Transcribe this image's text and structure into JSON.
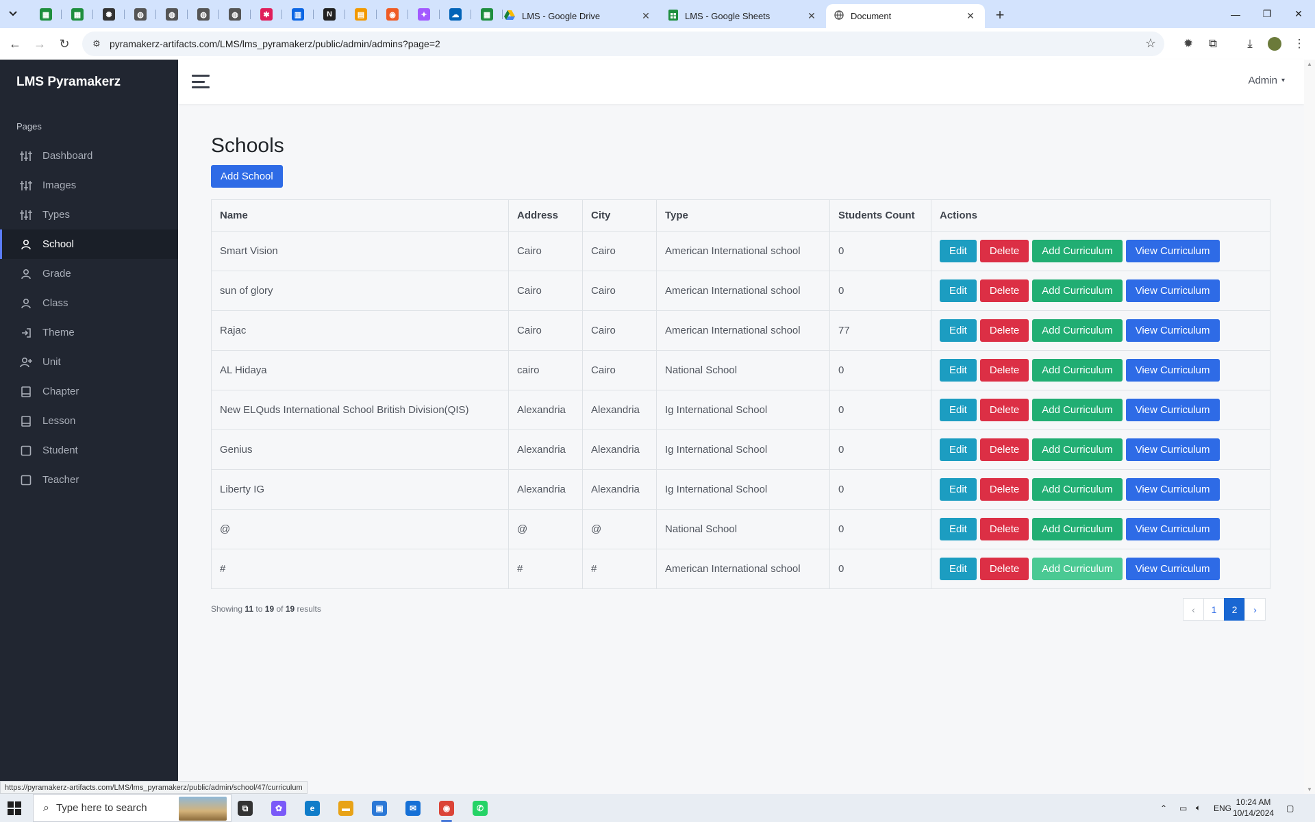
{
  "browser": {
    "pinned_tabs": [
      {
        "icon": "sheets-icon",
        "color": "#1e8e3e",
        "glyph": "▦"
      },
      {
        "icon": "sheets-icon",
        "color": "#1e8e3e",
        "glyph": "▦"
      },
      {
        "icon": "openai-icon",
        "color": "#333333",
        "glyph": "✺"
      },
      {
        "icon": "globe-icon",
        "color": "#555555",
        "glyph": "◍"
      },
      {
        "icon": "globe-icon",
        "color": "#555555",
        "glyph": "◍"
      },
      {
        "icon": "globe-icon",
        "color": "#555555",
        "glyph": "◍"
      },
      {
        "icon": "globe-icon",
        "color": "#555555",
        "glyph": "◍"
      },
      {
        "icon": "slack-icon",
        "color": "#e01e5a",
        "glyph": "✱"
      },
      {
        "icon": "trello-icon",
        "color": "#0c66e4",
        "glyph": "▥"
      },
      {
        "icon": "notion-icon",
        "color": "#222222",
        "glyph": "N"
      },
      {
        "icon": "slides-icon",
        "color": "#f29900",
        "glyph": "▤"
      },
      {
        "icon": "postman-icon",
        "color": "#ef5b25",
        "glyph": "◉"
      },
      {
        "icon": "figma-icon",
        "color": "#a259ff",
        "glyph": "✦"
      },
      {
        "icon": "onedrive-icon",
        "color": "#0364b8",
        "glyph": "☁"
      },
      {
        "icon": "sheets-icon",
        "color": "#1e8e3e",
        "glyph": "▦"
      }
    ],
    "tabs": [
      {
        "title": "LMS - Google Drive",
        "icon": "drive-icon"
      },
      {
        "title": "LMS - Google Sheets",
        "icon": "sheets-icon"
      },
      {
        "title": "Document",
        "icon": "globe-icon"
      }
    ],
    "url": "pyramakerz-artifacts.com/LMS/lms_pyramakerz/public/admin/admins?page=2",
    "status_url": "https://pyramakerz-artifacts.com/LMS/lms_pyramakerz/public/admin/school/47/curriculum"
  },
  "sidebar": {
    "brand": "LMS Pyramakerz",
    "heading": "Pages",
    "items": [
      {
        "label": "Dashboard",
        "icon": "sliders-icon"
      },
      {
        "label": "Images",
        "icon": "sliders-icon"
      },
      {
        "label": "Types",
        "icon": "sliders-icon"
      },
      {
        "label": "School",
        "icon": "user-icon"
      },
      {
        "label": "Grade",
        "icon": "user-icon"
      },
      {
        "label": "Class",
        "icon": "user-icon"
      },
      {
        "label": "Theme",
        "icon": "login-icon"
      },
      {
        "label": "Unit",
        "icon": "user-plus-icon"
      },
      {
        "label": "Chapter",
        "icon": "book-icon"
      },
      {
        "label": "Lesson",
        "icon": "book-icon"
      },
      {
        "label": "Student",
        "icon": "square-icon"
      },
      {
        "label": "Teacher",
        "icon": "square-icon"
      }
    ],
    "active": "School"
  },
  "topbar": {
    "user": "Admin"
  },
  "main": {
    "title": "Schools",
    "add_button": "Add School",
    "columns": [
      "Name",
      "Address",
      "City",
      "Type",
      "Students Count",
      "Actions"
    ],
    "action_labels": {
      "edit": "Edit",
      "delete": "Delete",
      "add_curriculum": "Add Curriculum",
      "view_curriculum": "View Curriculum"
    },
    "rows": [
      {
        "name": "Smart Vision",
        "address": "Cairo",
        "city": "Cairo",
        "type": "American International school",
        "count": "0"
      },
      {
        "name": "sun of glory",
        "address": "Cairo",
        "city": "Cairo",
        "type": "American International school",
        "count": "0"
      },
      {
        "name": "Rajac",
        "address": "Cairo",
        "city": "Cairo",
        "type": "American International school",
        "count": "77"
      },
      {
        "name": "AL Hidaya",
        "address": "cairo",
        "city": "Cairo",
        "type": "National School",
        "count": "0"
      },
      {
        "name": "New ELQuds International School British Division(QIS)",
        "address": "Alexandria",
        "city": "Alexandria",
        "type": "Ig International School",
        "count": "0"
      },
      {
        "name": "Genius",
        "address": "Alexandria",
        "city": "Alexandria",
        "type": "Ig International School",
        "count": "0"
      },
      {
        "name": "Liberty IG",
        "address": "Alexandria",
        "city": "Alexandria",
        "type": "Ig International School",
        "count": "0"
      },
      {
        "name": "@",
        "address": "@",
        "city": "@",
        "type": "National School",
        "count": "0"
      },
      {
        "name": "#",
        "address": "#",
        "city": "#",
        "type": "American International school",
        "count": "0"
      }
    ],
    "hovered_row": 8,
    "results": {
      "prefix": "Showing",
      "from": "11",
      "to_word": "to",
      "to": "19",
      "of_word": "of",
      "total": "19",
      "suffix": "results"
    },
    "pagination": {
      "prev": "‹",
      "pages": [
        "1",
        "2"
      ],
      "current": "2",
      "next": "›"
    }
  },
  "taskbar": {
    "search_placeholder": "Type here to search",
    "apps": [
      {
        "icon": "task-view-icon",
        "color": "#333333",
        "glyph": "⧉"
      },
      {
        "icon": "copilot-icon",
        "color": "#7a5af8",
        "glyph": "✿"
      },
      {
        "icon": "edge-icon",
        "color": "#0f7cc9",
        "glyph": "e"
      },
      {
        "icon": "file-explorer-icon",
        "color": "#e8a317",
        "glyph": "▬"
      },
      {
        "icon": "store-icon",
        "color": "#2b78d6",
        "glyph": "▣"
      },
      {
        "icon": "mail-icon",
        "color": "#1570d6",
        "glyph": "✉"
      },
      {
        "icon": "chrome-icon",
        "color": "#db4437",
        "glyph": "◉"
      },
      {
        "icon": "whatsapp-icon",
        "color": "#25d366",
        "glyph": "✆"
      }
    ],
    "language": "ENG",
    "time": "10:24 AM",
    "date": "10/14/2024"
  }
}
